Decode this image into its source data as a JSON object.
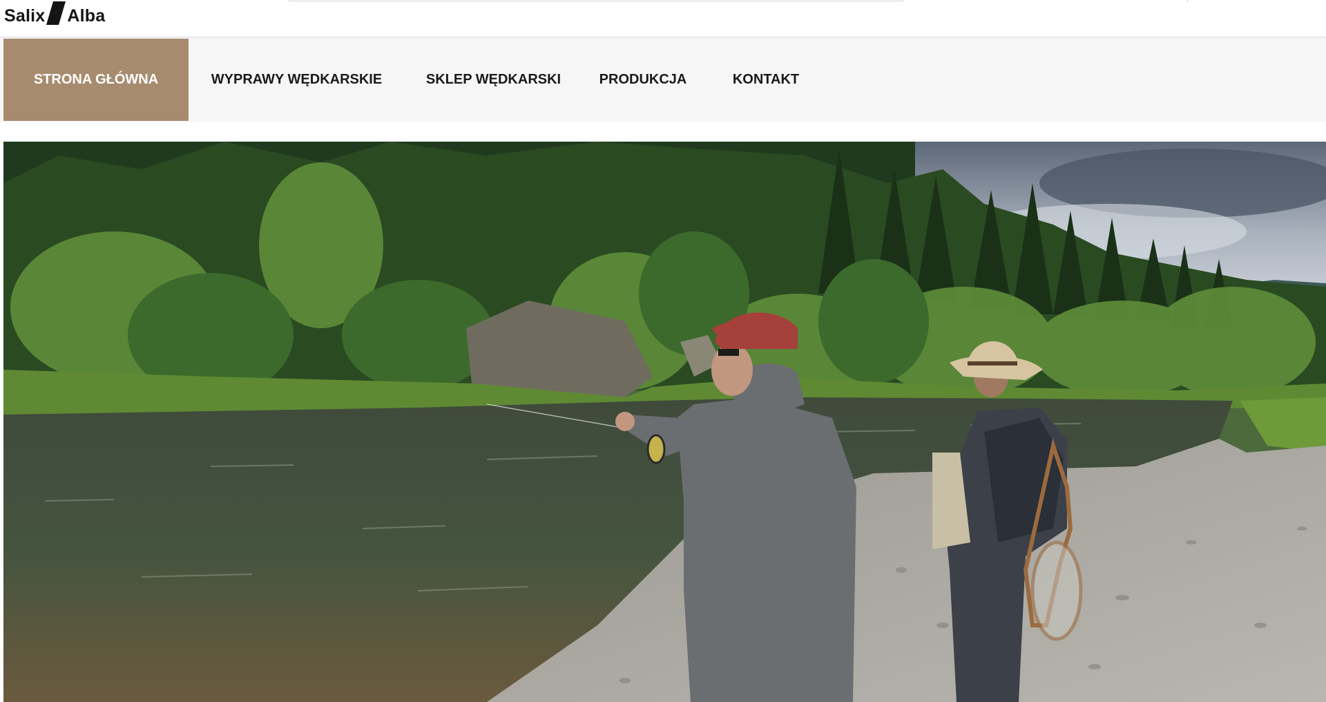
{
  "brand": {
    "name_left": "Salix",
    "name_right": "Alba",
    "logo_icon": "salix-alba-logo-mark"
  },
  "nav": {
    "items": [
      {
        "label": "STRONA GŁÓWNA",
        "active": true
      },
      {
        "label": "WYPRAWY WĘDKARSKIE",
        "active": false
      },
      {
        "label": "SKLEP WĘDKARSKI",
        "active": false
      },
      {
        "label": "PRODUKCJA",
        "active": false
      },
      {
        "label": "KONTAKT",
        "active": false
      }
    ]
  },
  "colors": {
    "accent": "#a68b6f",
    "nav_background": "#f6f6f6",
    "text": "#1a1a1a"
  }
}
